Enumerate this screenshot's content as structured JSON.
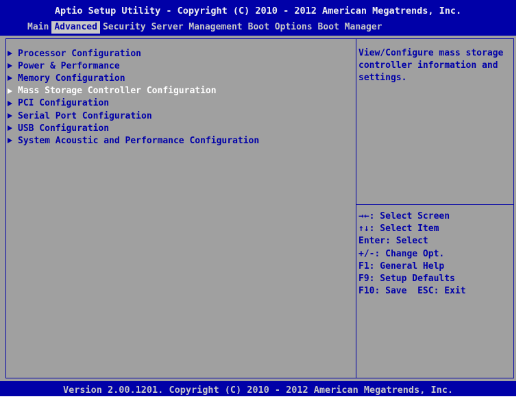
{
  "header": {
    "title": "Aptio Setup Utility - Copyright (C) 2010 - 2012 American Megatrends, Inc.",
    "tabs": [
      {
        "label": "Main",
        "active": false
      },
      {
        "label": "Advanced",
        "active": true
      },
      {
        "label": "Security",
        "active": false
      },
      {
        "label": "Server Management",
        "active": false
      },
      {
        "label": "Boot Options",
        "active": false
      },
      {
        "label": "Boot Manager",
        "active": false
      }
    ]
  },
  "menu": {
    "items": [
      {
        "label": "Processor Configuration",
        "selected": false
      },
      {
        "label": "Power & Performance",
        "selected": false
      },
      {
        "label": "Memory Configuration",
        "selected": false
      },
      {
        "label": "Mass Storage Controller Configuration",
        "selected": true
      },
      {
        "label": "PCI Configuration",
        "selected": false
      },
      {
        "label": "Serial Port Configuration",
        "selected": false
      },
      {
        "label": "USB Configuration",
        "selected": false
      },
      {
        "label": "System Acoustic and Performance Configuration",
        "selected": false
      }
    ]
  },
  "help": {
    "text": "View/Configure mass storage controller information and settings."
  },
  "keys": [
    "→←: Select Screen",
    "↑↓: Select Item",
    "Enter: Select",
    "+/-: Change Opt.",
    "F1: General Help",
    "F9: Setup Defaults",
    "F10: Save  ESC: Exit"
  ],
  "footer": {
    "text": "Version 2.00.1201. Copyright (C) 2010 - 2012 American Megatrends, Inc."
  },
  "colors": {
    "header_bg": "#0000a8",
    "body_bg": "#a0a0a0",
    "menu_text": "#0000a8",
    "selected_text": "#ffffff"
  }
}
